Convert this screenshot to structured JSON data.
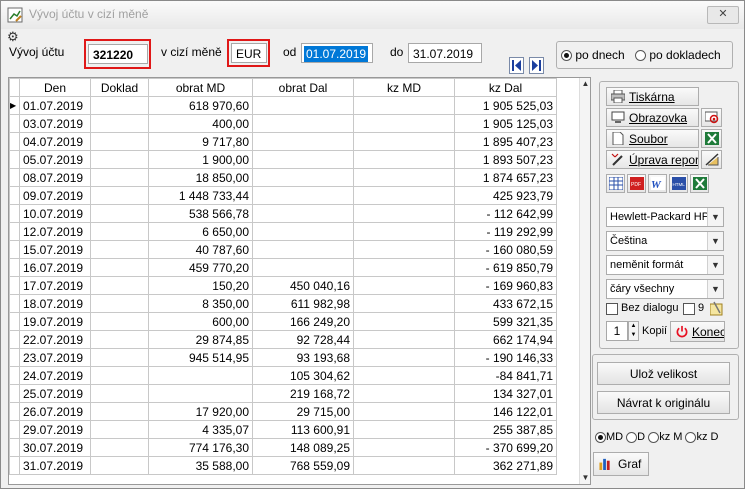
{
  "window": {
    "title": "Vývoj účtu v cizí měně",
    "close_label": "✕"
  },
  "filter": {
    "account_label": "Vývoj účtu",
    "account_value": "321220",
    "currency_label": "v cizí měně",
    "currency_value": "EUR",
    "from_label": "od",
    "from_value": "01.07.2019",
    "to_label": "do",
    "to_value": "31.07.2019",
    "mode_options": [
      {
        "label": "po dnech",
        "selected": true
      },
      {
        "label": "po dokladech",
        "selected": false
      }
    ]
  },
  "table": {
    "columns": [
      "Den",
      "Doklad",
      "obrat MD",
      "obrat Dal",
      "kz  MD",
      "kz  Dal"
    ],
    "rows": [
      {
        "den": "01.07.2019",
        "doklad": "",
        "obrat_md": "618 970,60",
        "obrat_dal": "",
        "kz_md": "",
        "kz_dal": "1 905 525,03",
        "current": true
      },
      {
        "den": "03.07.2019",
        "doklad": "",
        "obrat_md": "400,00",
        "obrat_dal": "",
        "kz_md": "",
        "kz_dal": "1 905 125,03"
      },
      {
        "den": "04.07.2019",
        "doklad": "",
        "obrat_md": "9 717,80",
        "obrat_dal": "",
        "kz_md": "",
        "kz_dal": "1 895 407,23"
      },
      {
        "den": "05.07.2019",
        "doklad": "",
        "obrat_md": "1 900,00",
        "obrat_dal": "",
        "kz_md": "",
        "kz_dal": "1 893 507,23"
      },
      {
        "den": "08.07.2019",
        "doklad": "",
        "obrat_md": "18 850,00",
        "obrat_dal": "",
        "kz_md": "",
        "kz_dal": "1 874 657,23"
      },
      {
        "den": "09.07.2019",
        "doklad": "",
        "obrat_md": "1 448 733,44",
        "obrat_dal": "",
        "kz_md": "",
        "kz_dal": "425 923,79"
      },
      {
        "den": "10.07.2019",
        "doklad": "",
        "obrat_md": "538 566,78",
        "obrat_dal": "",
        "kz_md": "",
        "kz_dal": "- 112 642,99"
      },
      {
        "den": "12.07.2019",
        "doklad": "",
        "obrat_md": "6 650,00",
        "obrat_dal": "",
        "kz_md": "",
        "kz_dal": "- 119 292,99"
      },
      {
        "den": "15.07.2019",
        "doklad": "",
        "obrat_md": "40 787,60",
        "obrat_dal": "",
        "kz_md": "",
        "kz_dal": "- 160 080,59"
      },
      {
        "den": "16.07.2019",
        "doklad": "",
        "obrat_md": "459 770,20",
        "obrat_dal": "",
        "kz_md": "",
        "kz_dal": "- 619 850,79"
      },
      {
        "den": "17.07.2019",
        "doklad": "",
        "obrat_md": "150,20",
        "obrat_dal": "450 040,16",
        "kz_md": "",
        "kz_dal": "- 169 960,83"
      },
      {
        "den": "18.07.2019",
        "doklad": "",
        "obrat_md": "8 350,00",
        "obrat_dal": "611 982,98",
        "kz_md": "",
        "kz_dal": "433 672,15"
      },
      {
        "den": "19.07.2019",
        "doklad": "",
        "obrat_md": "600,00",
        "obrat_dal": "166 249,20",
        "kz_md": "",
        "kz_dal": "599 321,35"
      },
      {
        "den": "22.07.2019",
        "doklad": "",
        "obrat_md": "29 874,85",
        "obrat_dal": "92 728,44",
        "kz_md": "",
        "kz_dal": "662 174,94"
      },
      {
        "den": "23.07.2019",
        "doklad": "",
        "obrat_md": "945 514,95",
        "obrat_dal": "93 193,68",
        "kz_md": "",
        "kz_dal": "- 190 146,33"
      },
      {
        "den": "24.07.2019",
        "doklad": "",
        "obrat_md": "",
        "obrat_dal": "105 304,62",
        "kz_md": "",
        "kz_dal": "-84 841,71"
      },
      {
        "den": "25.07.2019",
        "doklad": "",
        "obrat_md": "",
        "obrat_dal": "219 168,72",
        "kz_md": "",
        "kz_dal": "134 327,01"
      },
      {
        "den": "26.07.2019",
        "doklad": "",
        "obrat_md": "17 920,00",
        "obrat_dal": "29 715,00",
        "kz_md": "",
        "kz_dal": "146 122,01"
      },
      {
        "den": "29.07.2019",
        "doklad": "",
        "obrat_md": "4 335,07",
        "obrat_dal": "113 600,91",
        "kz_md": "",
        "kz_dal": "255 387,85"
      },
      {
        "den": "30.07.2019",
        "doklad": "",
        "obrat_md": "774 176,30",
        "obrat_dal": "148 089,25",
        "kz_md": "",
        "kz_dal": "- 370 699,20"
      },
      {
        "den": "31.07.2019",
        "doklad": "",
        "obrat_md": "35 588,00",
        "obrat_dal": "768 559,09",
        "kz_md": "",
        "kz_dal": "362 271,89"
      }
    ]
  },
  "output": {
    "printer_label": "Tiskárna",
    "screen_label": "Obrazovka",
    "file_label": "Soubor",
    "edit_report_label": "Úprava repor",
    "printer_select": "Hewlett-Packard HP",
    "language_select": "Čeština",
    "format_select": "neměnit formát",
    "lines_select": "čáry všechny",
    "no_dialog_label": "Bez dialogu",
    "no_dialog_checked": false,
    "font_size_value": "9",
    "font_size_checked": false,
    "copies_value": "1",
    "copies_label": "Kopií",
    "end_label": "Konec",
    "export_icons": [
      "table-icon",
      "pdf-icon",
      "word-icon",
      "html-icon",
      "excel-icon"
    ]
  },
  "actions": {
    "save_size_label": "Ulož velikost",
    "restore_label": "Návrat k originálu"
  },
  "graph": {
    "series_options": [
      {
        "label": "MD",
        "selected": true
      },
      {
        "label": "D",
        "selected": false
      },
      {
        "label": "kz M",
        "selected": false
      },
      {
        "label": "kz D",
        "selected": false
      }
    ],
    "graph_label": "Graf"
  },
  "colors": {
    "highlight": "#e01818",
    "selection": "#0078d7",
    "nav_icon": "#1c3f9e",
    "excel_green": "#1f7b3a",
    "stop_red": "#e81123"
  }
}
